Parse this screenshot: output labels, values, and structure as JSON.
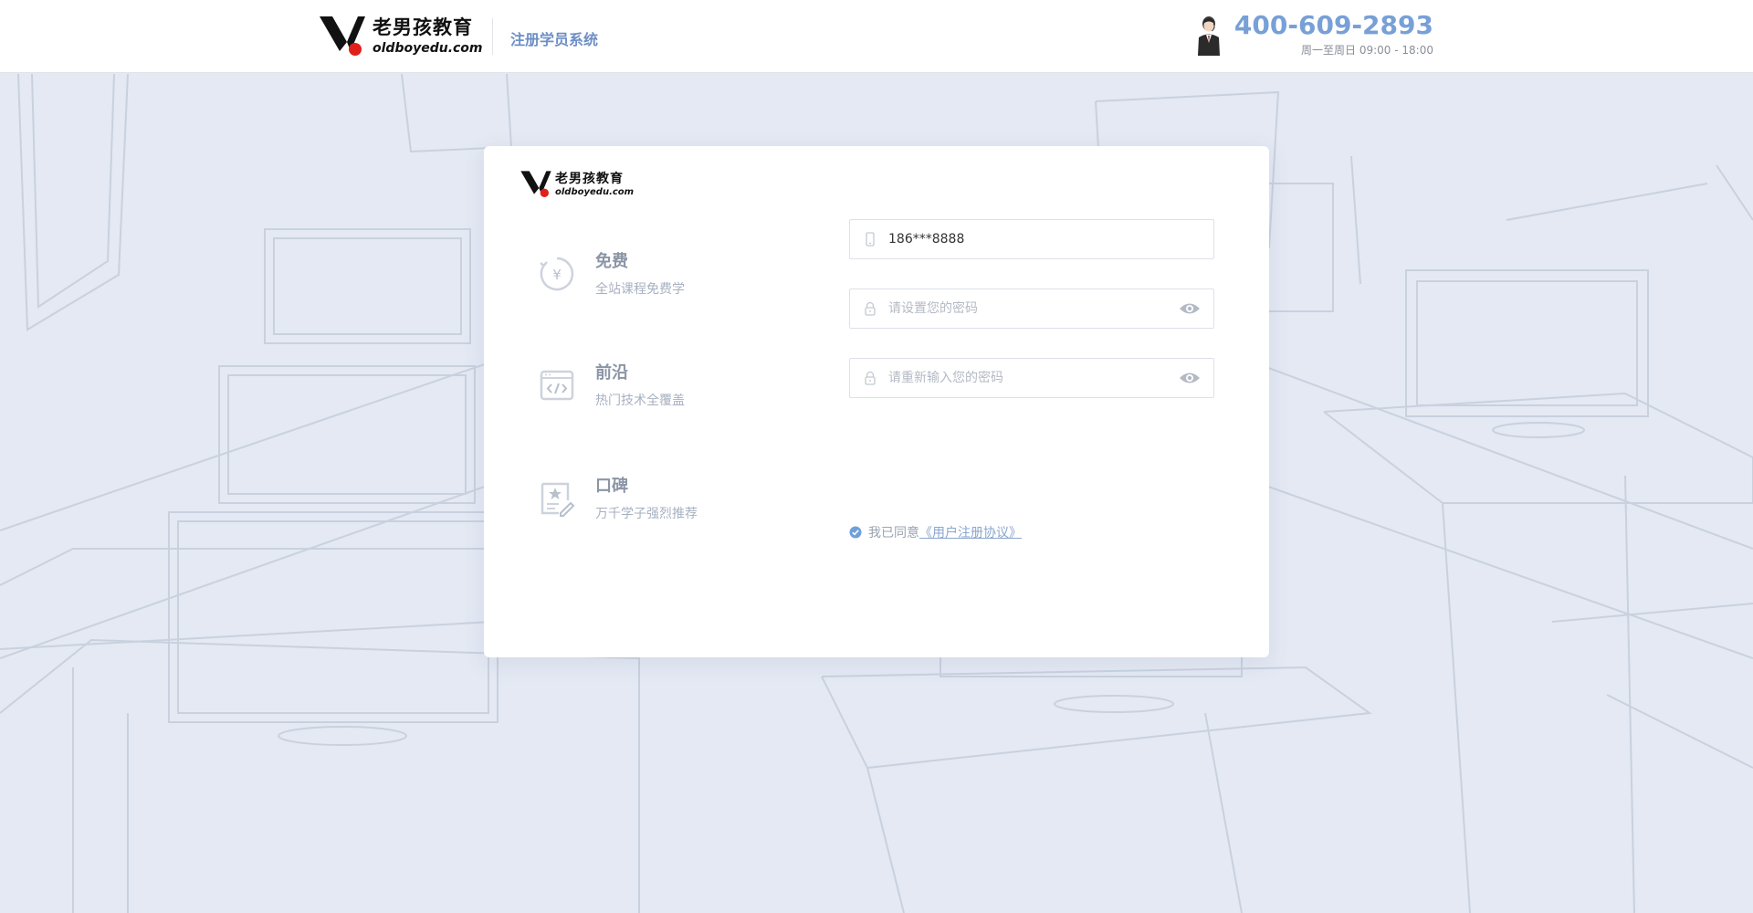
{
  "header": {
    "brand_cn": "老男孩教育",
    "brand_en": "oldboyedu.com",
    "system_title": "注册学员系统",
    "phone": "400-609-2893",
    "hours": "周一至周日 09:00 - 18:00"
  },
  "card": {
    "brand_cn": "老男孩教育",
    "brand_en": "oldboyedu.com",
    "features": [
      {
        "icon": "yuan-coin-icon",
        "title": "免费",
        "subtitle": "全站课程免费学"
      },
      {
        "icon": "code-window-icon",
        "title": "前沿",
        "subtitle": "热门技术全覆盖"
      },
      {
        "icon": "certificate-star-icon",
        "title": "口碑",
        "subtitle": "万千学子强烈推荐"
      }
    ],
    "form": {
      "phone_value": "186***8888",
      "password_placeholder": "请设置您的密码",
      "confirm_placeholder": "请重新输入您的密码",
      "agree_text": "我已同意",
      "agreement_link": "《用户注册协议》"
    }
  },
  "colors": {
    "accent": "#77a0d7",
    "system_title": "#6d8fc6",
    "background": "#e4e9f3",
    "check": "#6fa0dc"
  }
}
